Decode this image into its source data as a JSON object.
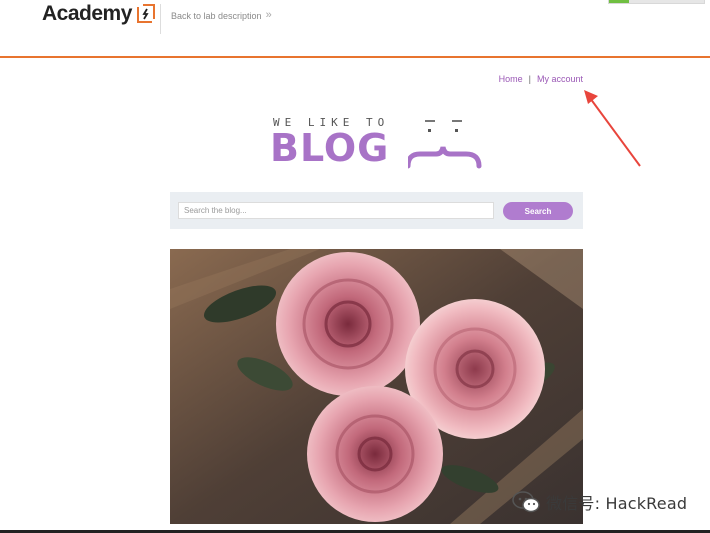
{
  "academy": {
    "logo_text": "Academy",
    "back_link": "Back to lab description",
    "back_chevron": "»"
  },
  "nav": {
    "home": "Home",
    "separator": "|",
    "my_account": "My account"
  },
  "header": {
    "tagline": "WE LIKE TO",
    "title": "BLOG"
  },
  "search": {
    "placeholder": "Search the blog...",
    "button_label": "Search"
  },
  "post": {
    "image_icon": "roses-photo"
  },
  "watermark": {
    "text": "微信号: HackRead",
    "icon": "wechat-icon"
  },
  "colors": {
    "accent": "#a873c7",
    "button": "#b07ccf",
    "academy_border": "#e8742f",
    "arrow": "#e8453c"
  }
}
